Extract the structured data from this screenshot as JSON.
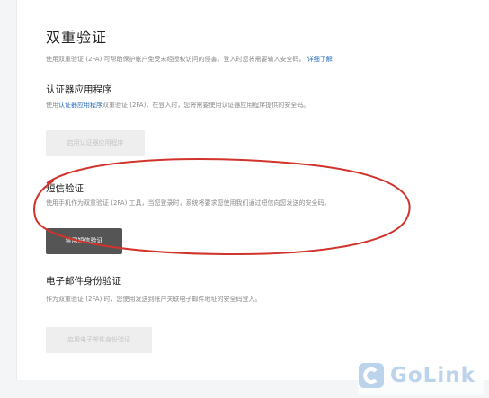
{
  "header": {
    "title": "双重验证",
    "description": "使用双重验证 (2FA) 可帮助保护帐户免受未经授权访问的侵害。登入时您将需要输入安全码。",
    "learn_more": "详细了解"
  },
  "authenticator": {
    "title": "认证器应用程序",
    "desc_prefix": "使用",
    "desc_link": "认证器应用程序",
    "desc_suffix": "双重验证 (2FA)，在登入时，您将需要使用认证器应用程序提供的安全码。",
    "button": "启用认证器应用程序"
  },
  "sms": {
    "title": "短信验证",
    "description": "使用手机作为双重验证 (2FA) 工具，当您登录时，系统将要求您使用我们通过短信向您发送的安全码。",
    "button": "禁用短信验证"
  },
  "email": {
    "title": "电子邮件身份验证",
    "description": "作为双重验证 (2FA) 时，您使用发送到帐户关联电子邮件地址的安全码登入。",
    "button": "启用电子邮件身份验证"
  },
  "watermark": {
    "text": "GoLink",
    "icon": "golink-logo-icon"
  },
  "colors": {
    "annotation": "#d0342c",
    "link": "#2e6fc0",
    "active_button": "#555555"
  }
}
